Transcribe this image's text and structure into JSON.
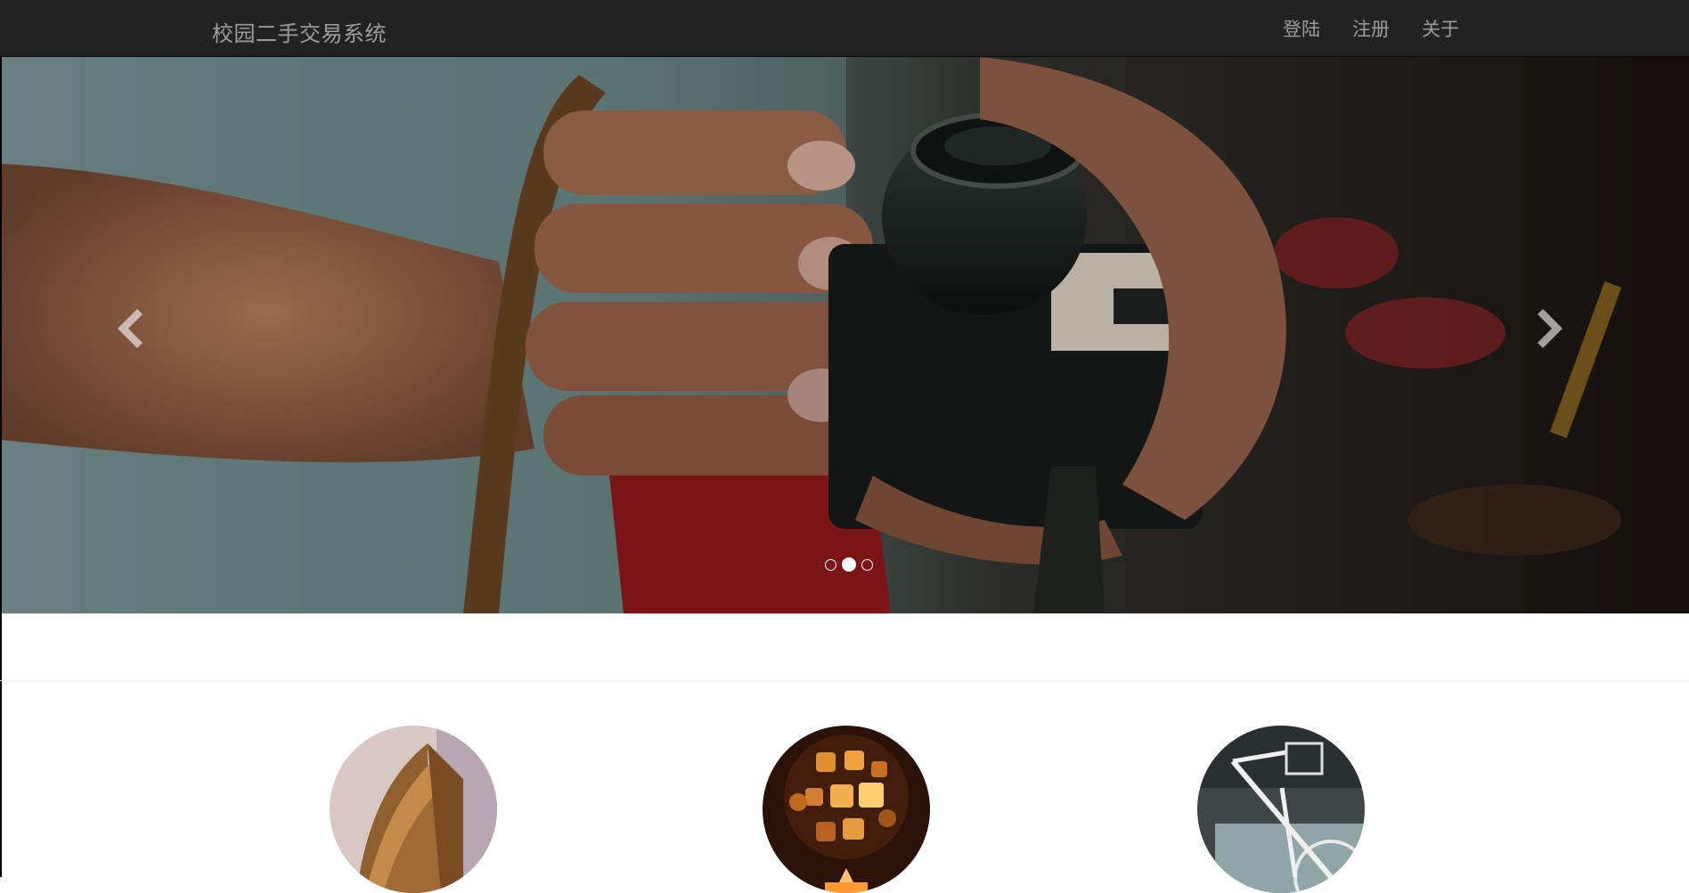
{
  "navbar": {
    "brand": "校园二手交易系统",
    "links": [
      {
        "label": "登陆"
      },
      {
        "label": "注册"
      },
      {
        "label": "关于"
      }
    ]
  },
  "carousel": {
    "image": "hands-holding-vintage-camera",
    "prev_icon": "chevron-left-icon",
    "next_icon": "chevron-right-icon",
    "slide_count": 3,
    "active_index": 1
  },
  "features": [
    {
      "image": "open-book"
    },
    {
      "image": "glowing-app-icons-projector"
    },
    {
      "image": "white-bicycle"
    }
  ],
  "colors": {
    "navbar_bg": "#222222",
    "nav_text": "#9d9d9d",
    "page_bg": "#ffffff"
  }
}
